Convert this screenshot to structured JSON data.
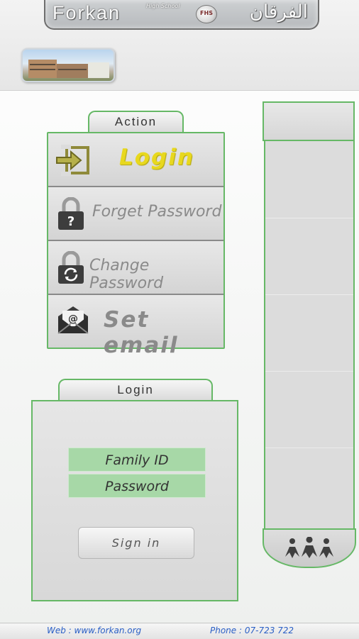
{
  "header": {
    "logo_en": "Forkan",
    "logo_subtitle": "High School",
    "logo_badge": "FHS",
    "logo_ar": "الفرقان"
  },
  "action_panel": {
    "tab_label": "Action",
    "items": [
      {
        "label": "Login",
        "icon": "login-arrow-icon",
        "color": "#e8d81e"
      },
      {
        "label": "Forget Password",
        "icon": "lock-question-icon"
      },
      {
        "label": "Change Password",
        "icon": "lock-refresh-icon"
      },
      {
        "label": "Set email",
        "icon": "envelope-at-icon"
      }
    ]
  },
  "login_panel": {
    "tab_label": "Login",
    "family_id_placeholder": "Family ID",
    "password_placeholder": "Password",
    "signin_label": "Sign in"
  },
  "footer": {
    "web": "Web : www.forkan.org",
    "phone": "Phone : 07-723 722"
  },
  "colors": {
    "accent_border": "#66b866",
    "field_fill": "#a7d8a7",
    "link_text": "#2a5fc6",
    "login_highlight": "#e8d81e"
  }
}
